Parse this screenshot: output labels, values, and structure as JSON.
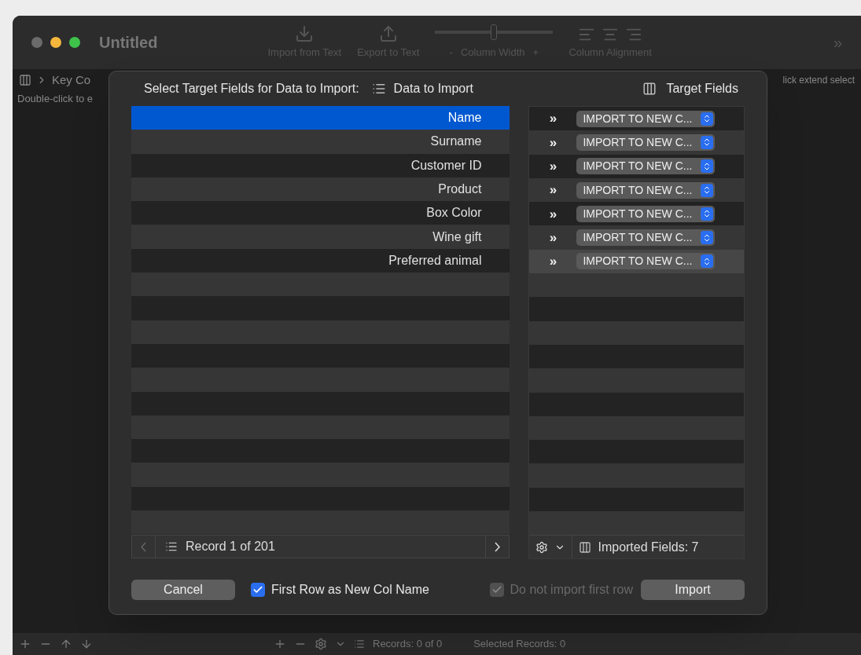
{
  "window": {
    "title": "Untitled"
  },
  "toolbar": {
    "items": [
      {
        "kind": "import",
        "label": "Import from Text"
      },
      {
        "kind": "export",
        "label": "Export to Text"
      }
    ],
    "width": {
      "level": 0.5,
      "minus": "-",
      "label": "Column Width",
      "plus": "+"
    },
    "alignment": {
      "label": "Column Alignment"
    },
    "overflow": "»"
  },
  "background": {
    "breadcrumb": "Key Co",
    "hint": "Double-click to e",
    "right_hint": "lick extend select"
  },
  "dialog": {
    "heading": "Select Target Fields for Data to Import:",
    "source_label": "Data to Import",
    "target_label": "Target Fields",
    "fields": [
      {
        "name": "Name",
        "selected": true,
        "target": "IMPORT TO NEW C...",
        "target_selected": false
      },
      {
        "name": "Surname",
        "selected": false,
        "target": "IMPORT TO NEW C...",
        "target_selected": false
      },
      {
        "name": "Customer ID",
        "selected": false,
        "target": "IMPORT TO NEW C...",
        "target_selected": false
      },
      {
        "name": "Product",
        "selected": false,
        "target": "IMPORT TO NEW C...",
        "target_selected": false
      },
      {
        "name": "Box Color",
        "selected": false,
        "target": "IMPORT TO NEW C...",
        "target_selected": false
      },
      {
        "name": "Wine gift",
        "selected": false,
        "target": "IMPORT TO NEW C...",
        "target_selected": false
      },
      {
        "name": "Preferred animal",
        "selected": false,
        "target": "IMPORT TO NEW C...",
        "target_selected": true
      }
    ],
    "arrow": "»",
    "record": "Record 1 of 201",
    "imported": "Imported Fields: 7",
    "cancel": "Cancel",
    "first_row": {
      "label": "First Row as New Col Name",
      "checked": true,
      "disabled": false
    },
    "skip_first": {
      "label": "Do not import first row",
      "checked": true,
      "disabled": true
    },
    "import": "Import"
  },
  "status_bar": {
    "records": "Records: 0 of 0",
    "selected": "Selected Records: 0"
  }
}
